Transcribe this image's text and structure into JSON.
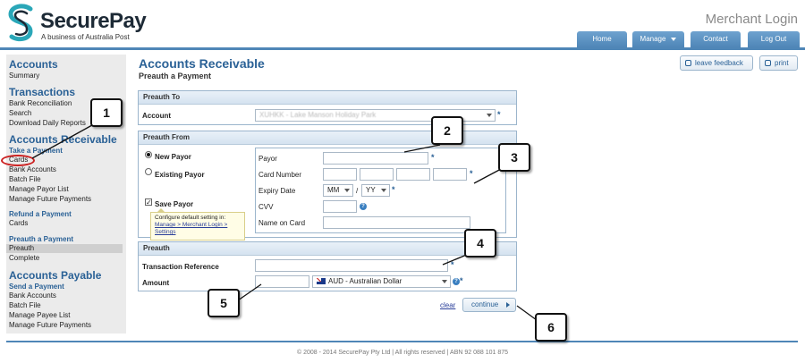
{
  "header": {
    "logo_name": "SecurePay",
    "logo_sub": "A business of Australia Post",
    "page_label": "Merchant Login",
    "nav": [
      "Home",
      "Manage",
      "Contact",
      "Log Out"
    ]
  },
  "sidebar": {
    "accounts": {
      "title": "Accounts",
      "items": [
        "Summary"
      ]
    },
    "transactions": {
      "title": "Transactions",
      "items": [
        "Bank Reconciliation",
        "Search",
        "Download Daily Reports"
      ]
    },
    "receivable": {
      "title": "Accounts Receivable",
      "take_payment": "Take a Payment",
      "take_payment_items": [
        "Cards",
        "Bank Accounts",
        "Batch File",
        "Manage Payor List",
        "Manage Future Payments"
      ],
      "refund": "Refund a Payment",
      "refund_items": [
        "Cards"
      ],
      "preauth": "Preauth a Payment",
      "preauth_items": [
        "Preauth",
        "Complete"
      ]
    },
    "payable": {
      "title": "Accounts Payable",
      "send_payment": "Send a Payment",
      "items": [
        "Bank Accounts",
        "Batch File",
        "Manage Payee List",
        "Manage Future Payments"
      ]
    }
  },
  "main": {
    "title": "Accounts Receivable",
    "subtitle": "Preauth a Payment",
    "leave_feedback": "leave feedback",
    "print": "print"
  },
  "preauth_to": {
    "heading": "Preauth To",
    "account_label": "Account",
    "account_value": "XUHKK - Lake Manson Holiday Park"
  },
  "preauth_from": {
    "heading": "Preauth From",
    "new_payor": "New Payor",
    "existing_payor": "Existing Payor",
    "save_payor": "Save Payor",
    "tooltip_text": "Configure default setting in:",
    "tooltip_link": "Manage > Merchant Login > Settings",
    "payor_label": "Payor",
    "card_number_label": "Card Number",
    "expiry_label": "Expiry Date",
    "expiry_month": "MM",
    "expiry_sep": "/",
    "expiry_year": "YY",
    "cvv_label": "CVV",
    "name_label": "Name on Card"
  },
  "preauth": {
    "heading": "Preauth",
    "transaction_ref_label": "Transaction Reference",
    "amount_label": "Amount",
    "currency": "AUD - Australian Dollar"
  },
  "actions": {
    "clear": "clear",
    "continue": "continue"
  },
  "footer": "© 2008 - 2014 SecurePay Pty Ltd | All rights reserved | ABN 92 088 101 875",
  "callouts": [
    "1",
    "2",
    "3",
    "4",
    "5",
    "6"
  ],
  "colors": {
    "brand_blue": "#2a6196",
    "nav_blue": "#4f86b7",
    "highlight_red": "#cc2222"
  }
}
